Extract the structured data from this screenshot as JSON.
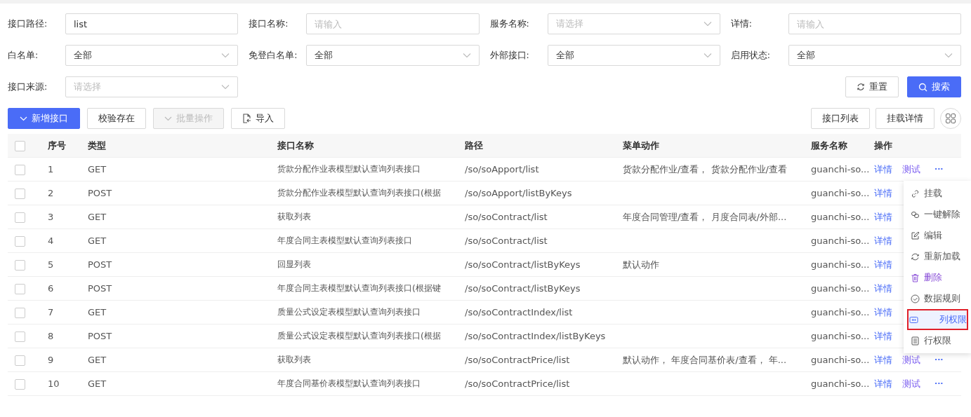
{
  "filters": [
    {
      "label": "接口路径:",
      "kind": "input",
      "value": "list"
    },
    {
      "label": "接口名称:",
      "kind": "input",
      "placeholder": "请输入"
    },
    {
      "label": "服务名称:",
      "kind": "select",
      "placeholder": "请选择"
    },
    {
      "label": "详情:",
      "kind": "input",
      "placeholder": "请输入"
    },
    {
      "label": "白名单:",
      "kind": "select",
      "value": "全部"
    },
    {
      "label": "免登白名单:",
      "kind": "select",
      "value": "全部"
    },
    {
      "label": "外部接口:",
      "kind": "select",
      "value": "全部"
    },
    {
      "label": "启用状态:",
      "kind": "select",
      "value": "全部"
    },
    {
      "label": "接口来源:",
      "kind": "select",
      "placeholder": "请选择"
    }
  ],
  "search_buttons": [
    {
      "label": "重置",
      "kind": "reset"
    },
    {
      "label": "搜索",
      "kind": "search"
    }
  ],
  "toolbar": [
    {
      "label": "新增接口",
      "kind": "primary-dropdown",
      "disabled": false
    },
    {
      "label": "校验存在",
      "kind": "plain",
      "disabled": false
    },
    {
      "label": "批量操作",
      "kind": "dropdown",
      "disabled": true
    },
    {
      "label": "导入",
      "kind": "import",
      "disabled": false
    }
  ],
  "view_buttons": [
    "接口列表",
    "挂载详情"
  ],
  "table": {
    "all_checked": false,
    "columns": [
      "序号",
      "类型",
      "接口名称",
      "路径",
      "菜单动作",
      "服务名称",
      "操作"
    ],
    "rows": [
      {
        "checked": false,
        "cells": [
          "1",
          "GET",
          "货款分配作业表模型默认查询列表接口",
          "/so/soApport/list",
          "货款分配作业/查看， 货款分配作业/查看",
          "guanchi-so..."
        ],
        "actions": [
          "详情",
          "测试"
        ],
        "more": true
      },
      {
        "checked": false,
        "cells": [
          "2",
          "POST",
          "货款分配作业表模型默认查询列表接口(根据",
          "/so/soApport/listByKeys",
          "",
          "guanchi-so..."
        ],
        "actions": [
          "详情"
        ],
        "more": false
      },
      {
        "checked": false,
        "cells": [
          "3",
          "GET",
          "获取列表",
          "/so/soContract/list",
          "年度合同管理/查看， 月度合同表/外部...",
          "guanchi-so..."
        ],
        "actions": [
          "详情"
        ],
        "more": false
      },
      {
        "checked": false,
        "cells": [
          "4",
          "GET",
          "年度合同主表模型默认查询列表接口",
          "/so/soContract/list",
          "",
          "guanchi-so..."
        ],
        "actions": [
          "详情"
        ],
        "more": false
      },
      {
        "checked": false,
        "cells": [
          "5",
          "POST",
          "回显列表",
          "/so/soContract/listByKeys",
          "默认动作",
          "guanchi-so..."
        ],
        "actions": [
          "详情"
        ],
        "more": false
      },
      {
        "checked": false,
        "cells": [
          "6",
          "POST",
          "年度合同主表模型默认查询列表接口(根据键",
          "/so/soContract/listByKeys",
          "",
          "guanchi-so..."
        ],
        "actions": [
          "详情"
        ],
        "more": false
      },
      {
        "checked": false,
        "cells": [
          "7",
          "GET",
          "质量公式设定表模型默认查询列表接口",
          "/so/soContractIndex/list",
          "",
          "guanchi-so..."
        ],
        "actions": [
          "详情"
        ],
        "more": false
      },
      {
        "checked": false,
        "cells": [
          "8",
          "POST",
          "质量公式设定表模型默认查询列表接口(根据",
          "/so/soContractIndex/listByKeys",
          "",
          "guanchi-so..."
        ],
        "actions": [
          "详情"
        ],
        "more": false
      },
      {
        "checked": false,
        "cells": [
          "9",
          "GET",
          "获取列表",
          "/so/soContractPrice/list",
          "默认动作， 年度合同基价表/查看， 年...",
          "guanchi-so..."
        ],
        "actions": [
          "详情",
          "测试"
        ],
        "more": true
      },
      {
        "checked": false,
        "cells": [
          "10",
          "GET",
          "年度合同基价表模型默认查询列表接口",
          "/so/soContractPrice/list",
          "",
          "guanchi-so..."
        ],
        "actions": [
          "详情",
          "测试"
        ],
        "more": true
      }
    ]
  },
  "more_glyph": "···",
  "menu": [
    {
      "label": "挂载",
      "kind": "link",
      "selected": false,
      "danger": false
    },
    {
      "label": "一键解除",
      "kind": "unlink",
      "selected": false,
      "danger": false
    },
    {
      "label": "编辑",
      "kind": "edit",
      "selected": false,
      "danger": false
    },
    {
      "label": "重新加载",
      "kind": "reload",
      "selected": false,
      "danger": false
    },
    {
      "label": "删除",
      "kind": "delete",
      "selected": false,
      "danger": true
    },
    {
      "label": "数据规则",
      "kind": "rule",
      "selected": false,
      "danger": false
    },
    {
      "label": "列权限",
      "kind": "column",
      "selected": true,
      "danger": false
    },
    {
      "label": "行权限",
      "kind": "row",
      "selected": false,
      "danger": false
    }
  ]
}
